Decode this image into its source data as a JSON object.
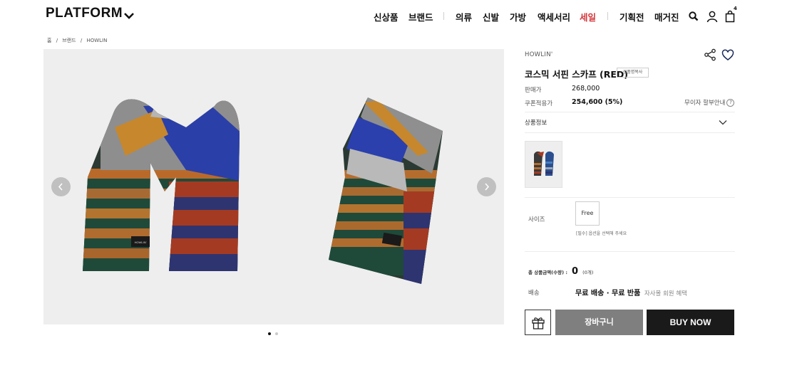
{
  "header": {
    "logo": "PLATFORM",
    "nav": [
      "신상품",
      "브랜드",
      "의류",
      "신발",
      "가방",
      "액세서리",
      "세일",
      "기획전",
      "매거진"
    ],
    "cart_count": "4"
  },
  "breadcrumb": [
    "홈",
    "/",
    "브랜드",
    "/",
    "HOWLIN"
  ],
  "gallery": {
    "slide_count": 2,
    "active_slide": 1,
    "label_text": "HOWLIN'"
  },
  "product": {
    "brand": "HOWLIN'",
    "title": "코스믹 서핀 스카프 (RED)",
    "copy_button": "상품명복사",
    "price_label": "판매가",
    "price": "268,000",
    "coupon_label": "쿠폰적용가",
    "coupon_price": "254,600 (5%)",
    "installment": "무이자 할부안내",
    "info_label": "상품정보",
    "size_label": "사이즈",
    "size_option": "Free",
    "size_note": "[필수] 옵션을 선택해 주세요",
    "total_label": "총 상품금액(수량) :",
    "total_value": "0",
    "total_count": "(0개)",
    "shipping_label": "배송",
    "shipping_value": "무료 배송 · 무료 반품",
    "shipping_sub": "자사몰 회원 혜택",
    "cart_button": "장바구니",
    "buy_button": "BUY NOW"
  },
  "colors": {
    "sale": "#d4353a",
    "gallery_bg": "#eeeeee",
    "cart_btn": "#7f7f7f",
    "buy_btn": "#1a1a1a"
  }
}
